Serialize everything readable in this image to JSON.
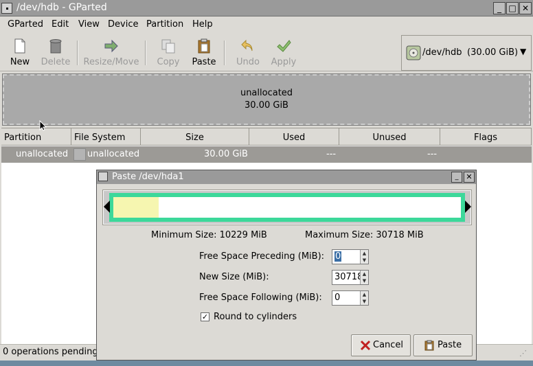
{
  "window": {
    "title": "/dev/hdb - GParted"
  },
  "menu": [
    "GParted",
    "Edit",
    "View",
    "Device",
    "Partition",
    "Help"
  ],
  "toolbar": {
    "new": "New",
    "delete": "Delete",
    "resize_move": "Resize/Move",
    "copy": "Copy",
    "paste": "Paste",
    "undo": "Undo",
    "apply": "Apply"
  },
  "device": {
    "path": "/dev/hdb",
    "size": "(30.00 GiB)"
  },
  "diskmap": {
    "label": "unallocated",
    "size": "30.00 GiB"
  },
  "table": {
    "headers": [
      "Partition",
      "File System",
      "Size",
      "Used",
      "Unused",
      "Flags"
    ],
    "rows": [
      {
        "partition": "unallocated",
        "filesystem": "unallocated",
        "size": "30.00 GiB",
        "used": "---",
        "unused": "---",
        "flags": ""
      }
    ]
  },
  "status": {
    "text": "0 operations pending"
  },
  "dialog": {
    "title": "Paste /dev/hda1",
    "min_size": "Minimum Size: 10229 MiB",
    "max_size": "Maximum Size: 30718 MiB",
    "preceding_label": "Free Space Preceding (MiB):",
    "preceding_value": "0",
    "new_size_label": "New Size (MiB):",
    "new_size_value": "30718",
    "following_label": "Free Space Following (MiB):",
    "following_value": "0",
    "round_label": "Round to cylinders",
    "round_checked": true,
    "cancel": "Cancel",
    "paste": "Paste",
    "used_fraction": 0.13
  },
  "colors": {
    "partition_border": "#3cd89a",
    "used_fill": "#f6f6b0",
    "unallocated": "#a9a9a9"
  }
}
